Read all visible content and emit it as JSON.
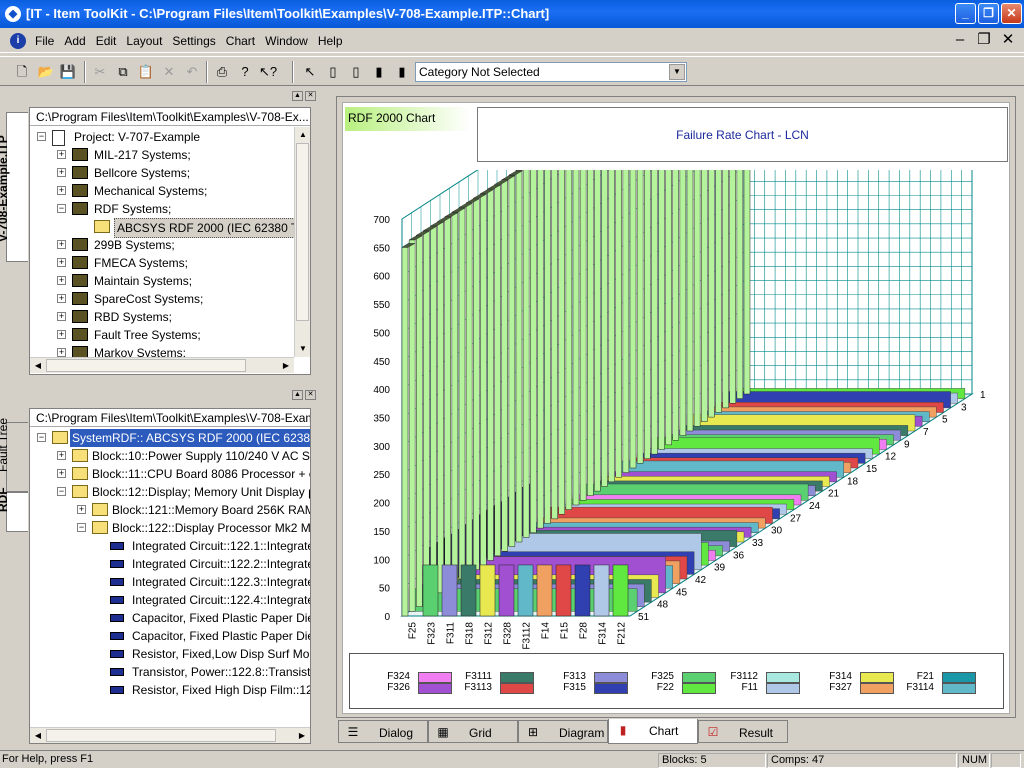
{
  "window": {
    "title": "[IT - Item ToolKit - C:\\Program Files\\Item\\Toolkit\\Examples\\V-708-Example.ITP::Chart]",
    "minimize": "_",
    "restore": "❐",
    "close": "✕"
  },
  "menu": {
    "items": [
      "File",
      "Add",
      "Edit",
      "Layout",
      "Settings",
      "Chart",
      "Window",
      "Help"
    ]
  },
  "toolbar": {
    "category_select": "Category Not Selected"
  },
  "upper_panel": {
    "tab_label": "V-708-Example.ITP",
    "path": "C:\\Program Files\\Item\\Toolkit\\Examples\\V-708-Ex...",
    "rows": [
      {
        "label": "Project:  V-707-Example"
      },
      {
        "label": "MIL-217 Systems;"
      },
      {
        "label": "Bellcore Systems;"
      },
      {
        "label": "Mechanical Systems;"
      },
      {
        "label": "RDF Systems;"
      },
      {
        "label": "ABCSYS RDF 2000 (IEC 62380 TR E"
      },
      {
        "label": "299B Systems;"
      },
      {
        "label": "FMECA Systems;"
      },
      {
        "label": "Maintain Systems;"
      },
      {
        "label": "SpareCost Systems;"
      },
      {
        "label": "RBD Systems;"
      },
      {
        "label": "Fault Tree Systems;"
      },
      {
        "label": "Markov Systems;"
      }
    ]
  },
  "lower_panel": {
    "tabs": [
      "Fault Tree",
      "RDF"
    ],
    "path": "C:\\Program Files\\Item\\Toolkit\\Examples\\V-708-Examp...",
    "rows": [
      {
        "label": "SystemRDF:: ABCSYS RDF 2000 (IEC 62380 TR"
      },
      {
        "label": "Block::10::Power Supply 110/240 V AC Suppl"
      },
      {
        "label": "Block::11::CPU Board 8086 Processor + on-bo"
      },
      {
        "label": "Block::12::Display; Memory Unit Display proce"
      },
      {
        "label": "Block::121::Memory Board 256K RAM + 1"
      },
      {
        "label": "Block::122::Display Processor Mk2 Monoc"
      },
      {
        "label": "Integrated Circuit::122.1::Integrated C"
      },
      {
        "label": "Integrated Circuit::122.2::Integrated C"
      },
      {
        "label": "Integrated Circuit::122.3::Integrated C"
      },
      {
        "label": "Integrated Circuit::122.4::Integrated C"
      },
      {
        "label": "Capacitor, Fixed Plastic Paper Dielect"
      },
      {
        "label": "Capacitor, Fixed Plastic Paper Dielect"
      },
      {
        "label": "Resistor, Fixed,Low Disp Surf Mount/l"
      },
      {
        "label": "Transistor, Power::122.8::Transistor, F"
      },
      {
        "label": "Resistor, Fixed High Disp Film::122.9::"
      }
    ]
  },
  "chart_header": {
    "badge": "RDF 2000 Chart",
    "title": "Failure Rate Chart - LCN"
  },
  "chart_data": {
    "type": "bar",
    "title": "Failure Rate Chart - LCN",
    "yticks": [
      "700",
      "650",
      "600",
      "550",
      "500",
      "450",
      "400",
      "350",
      "300",
      "250",
      "200",
      "150",
      "100",
      "50",
      "0"
    ],
    "ylim": [
      0,
      700
    ],
    "x_categories": [
      "F25",
      "F323",
      "F311",
      "F318",
      "F312",
      "F328",
      "F3112",
      "F14",
      "F15",
      "F28",
      "F314",
      "F212"
    ],
    "depth_labels": [
      "1",
      "3",
      "5",
      "7",
      "9",
      "12",
      "15",
      "18",
      "21",
      "24",
      "27",
      "30",
      "33",
      "36",
      "39",
      "42",
      "45",
      "48",
      "51"
    ],
    "front_row_values": [
      650,
      90,
      90,
      90,
      90,
      90,
      90,
      90,
      90,
      90,
      90,
      90
    ],
    "back_row_value": 655,
    "grid": true
  },
  "legend": {
    "items": [
      {
        "label": "F324",
        "color": "#f07ef0"
      },
      {
        "label": "F3111",
        "color": "#3a7a68"
      },
      {
        "label": "F313",
        "color": "#8c8cd8"
      },
      {
        "label": "F325",
        "color": "#5ad070"
      },
      {
        "label": "F3112",
        "color": "#a8e8e0"
      },
      {
        "label": "F314",
        "color": "#e8e850"
      },
      {
        "label": "F21",
        "color": "#1a98a8"
      },
      {
        "label": "F326",
        "color": "#a050d0"
      },
      {
        "label": "F3113",
        "color": "#e04848"
      },
      {
        "label": "F315",
        "color": "#3040b0"
      },
      {
        "label": "F22",
        "color": "#60e840"
      },
      {
        "label": "F11",
        "color": "#b0c8e8"
      },
      {
        "label": "F327",
        "color": "#f0a060"
      },
      {
        "label": "F3114",
        "color": "#60b8c8"
      }
    ]
  },
  "view_tabs": {
    "items": [
      "Dialog",
      "Grid",
      "Diagram",
      "Chart",
      "Result"
    ],
    "active": "Chart"
  },
  "status": {
    "help": "For Help, press F1",
    "blocks": "Blocks: 5",
    "comps": "Comps: 47",
    "num": "NUM"
  }
}
